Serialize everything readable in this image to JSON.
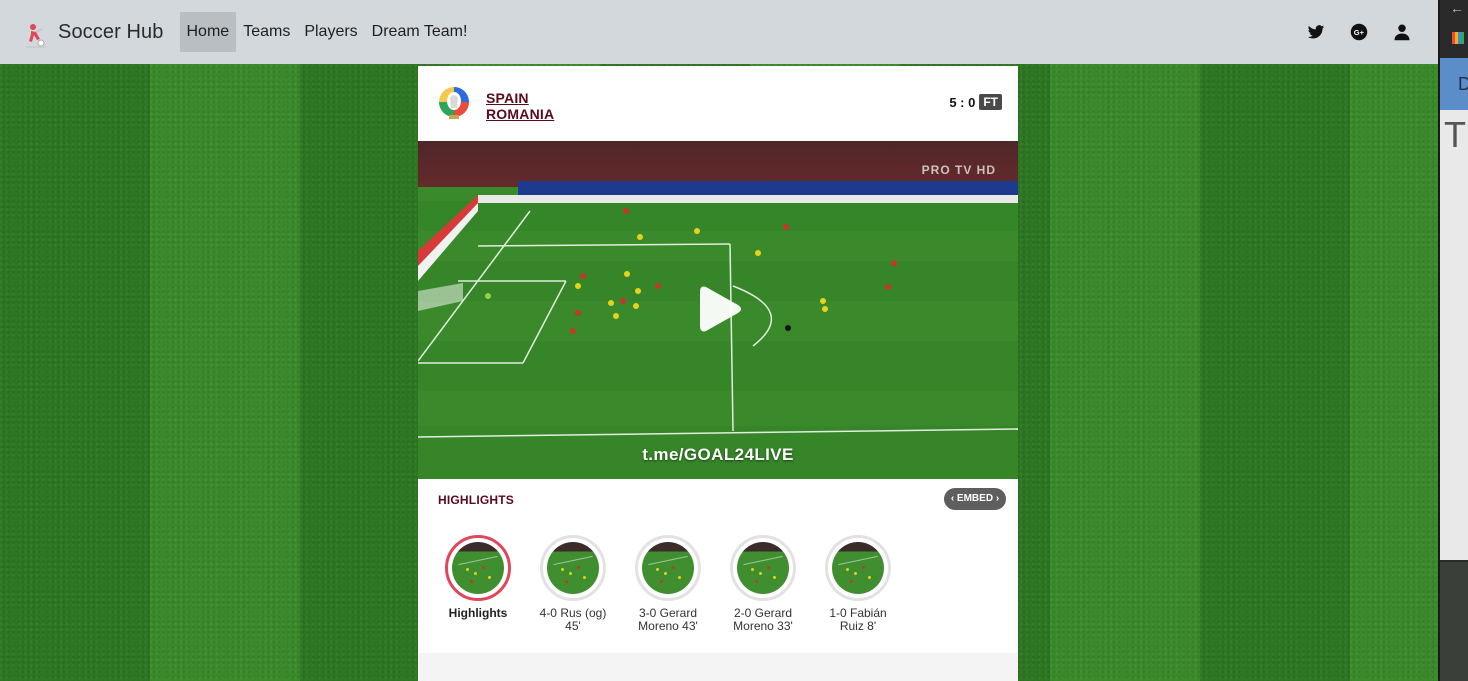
{
  "app": {
    "brand_name": "Soccer Hub",
    "nav_links": [
      "Home",
      "Teams",
      "Players",
      "Dream Team!"
    ],
    "active_link": "Home",
    "icons": [
      "twitter-icon",
      "google-plus-icon",
      "user-icon"
    ]
  },
  "match": {
    "home_team": "SPAIN",
    "away_team": "ROMANIA",
    "score": "5 : 0",
    "status": "FT",
    "video": {
      "watermark": "t.me/GOAL24LIVE",
      "broadcaster": "PRO TV HD"
    }
  },
  "highlights": {
    "title": "HIGHLIGHTS",
    "embed_label": "‹ EMBED ›",
    "clips": [
      {
        "label": "Highlights",
        "selected": true
      },
      {
        "label": "4-0 Rus (og) 45'",
        "selected": false
      },
      {
        "label": "3-0 Gerard Moreno 43'",
        "selected": false
      },
      {
        "label": "2-0 Gerard Moreno 33'",
        "selected": false
      },
      {
        "label": "1-0 Fabián Ruiz 8'",
        "selected": false
      }
    ]
  },
  "side_panel": {
    "letter_top": "D",
    "letter_mid": "Tl"
  },
  "colors": {
    "navbar_bg": "#d3d8dd",
    "team_name": "#5a0a1c",
    "selected_ring": "#e0475a",
    "grass_dark": "#2d7622",
    "grass_light": "#3a8a2b"
  }
}
